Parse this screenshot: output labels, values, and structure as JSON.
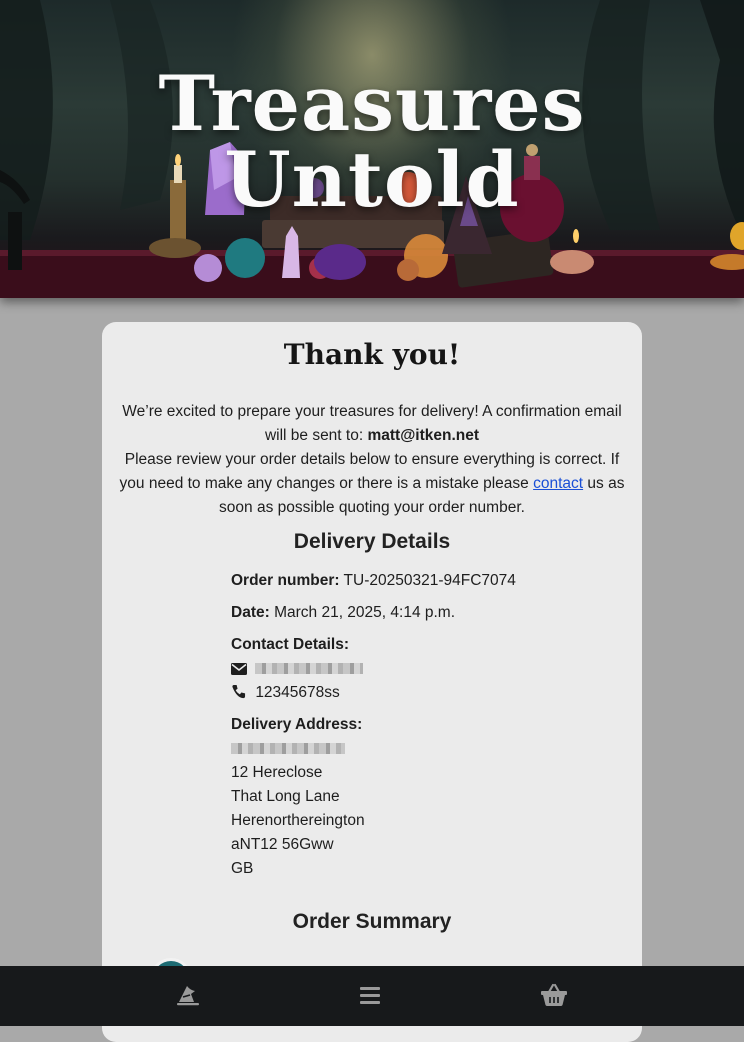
{
  "header": {
    "title": "Treasures Untold"
  },
  "card": {
    "heading": "Thank you!",
    "intro_line1": "We’re excited to prepare your treasures for delivery! A confirmation email will be sent to: ",
    "email": "matt@itken.net",
    "intro_line2": "Please review your order details below to ensure everything is correct. If you need to make any changes or there is a mistake please ",
    "contact_link": "contact",
    "intro_line3": " us as soon as possible quoting your order number."
  },
  "delivery": {
    "section_title": "Delivery Details",
    "order_number_label": "Order number:",
    "order_number": "TU-20250321-94FC7074",
    "date_label": "Date:",
    "date": "March 21, 2025, 4:14 p.m.",
    "contact_label": "Contact Details:",
    "phone": "12345678ss",
    "address_label": "Delivery Address:",
    "address_lines": [
      "12 Hereclose",
      "That Long Lane",
      "Herenorthereington",
      "aNT12 56Gww",
      "GB"
    ]
  },
  "summary": {
    "section_title": "Order Summary"
  },
  "icons": {
    "email": "envelope-icon",
    "phone": "phone-icon",
    "nav_home": "wizard-hat-icon",
    "nav_menu": "hamburger-menu-icon",
    "nav_basket": "shopping-basket-icon"
  },
  "colors": {
    "page_bg": "#a9a9a9",
    "card_bg": "#ebebeb",
    "nav_bg": "#17191b",
    "link": "#1a4fd6"
  }
}
